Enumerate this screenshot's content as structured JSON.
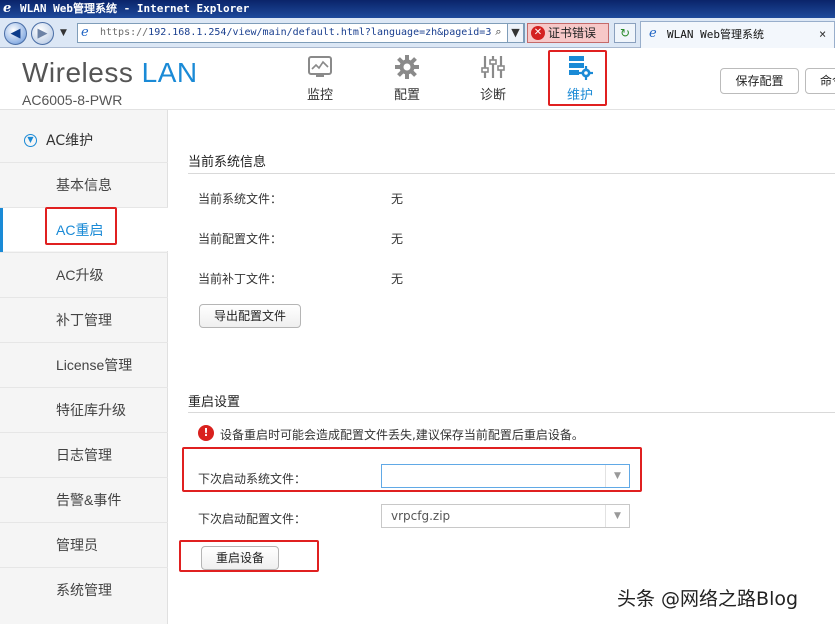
{
  "browser": {
    "window_title": "WLAN Web管理系统 - Internet Explorer",
    "url_proto": "https://",
    "url_rest": "192.168.1.254/view/main/default.html?language=zh&pageid=3",
    "search_glyph": "⌕",
    "dropdown_glyph": "▼",
    "cert_error": "证书错误",
    "tab_title": "WLAN Web管理系统",
    "tab_close": "×",
    "back_glyph": "◀",
    "forward_glyph": "▶",
    "ie_glyph": "e",
    "refresh_glyph": "↻",
    "cert_x": "✕"
  },
  "header": {
    "brand_wireless": "Wireless",
    "brand_lan": "LAN",
    "model": "AC6005-8-PWR",
    "nav": [
      {
        "label": "监控",
        "icon": "monitor-icon"
      },
      {
        "label": "配置",
        "icon": "gear-icon"
      },
      {
        "label": "诊断",
        "icon": "sliders-icon"
      },
      {
        "label": "维护",
        "icon": "server-gear-icon",
        "active": true
      }
    ],
    "save_config": "保存配置",
    "command_partial": "命令"
  },
  "sidebar": {
    "section": "AC维护",
    "items": [
      {
        "label": "基本信息"
      },
      {
        "label": "AC重启",
        "selected": true
      },
      {
        "label": "AC升级"
      },
      {
        "label": "补丁管理"
      },
      {
        "label": "License管理"
      },
      {
        "label": "特征库升级"
      },
      {
        "label": "日志管理"
      },
      {
        "label": "告警&事件"
      },
      {
        "label": "管理员"
      },
      {
        "label": "系统管理"
      }
    ]
  },
  "main": {
    "system_info": {
      "title": "当前系统信息",
      "rows": [
        {
          "label": "当前系统文件：",
          "value": "无"
        },
        {
          "label": "当前配置文件：",
          "value": "无"
        },
        {
          "label": "当前补丁文件：",
          "value": "无"
        }
      ],
      "export_button": "导出配置文件"
    },
    "restart": {
      "title": "重启设置",
      "warning": "设备重启时可能会造成配置文件丢失,建议保存当前配置后重启设备。",
      "next_system_file_label": "下次启动系统文件：",
      "next_system_file_value": "",
      "next_config_file_label": "下次启动配置文件：",
      "next_config_file_value": "vrpcfg.zip",
      "restart_button": "重启设备"
    }
  },
  "watermark": "头条 @网络之路Blog",
  "colors": {
    "accent": "#1a8ad6",
    "highlight_box": "#e02020"
  }
}
